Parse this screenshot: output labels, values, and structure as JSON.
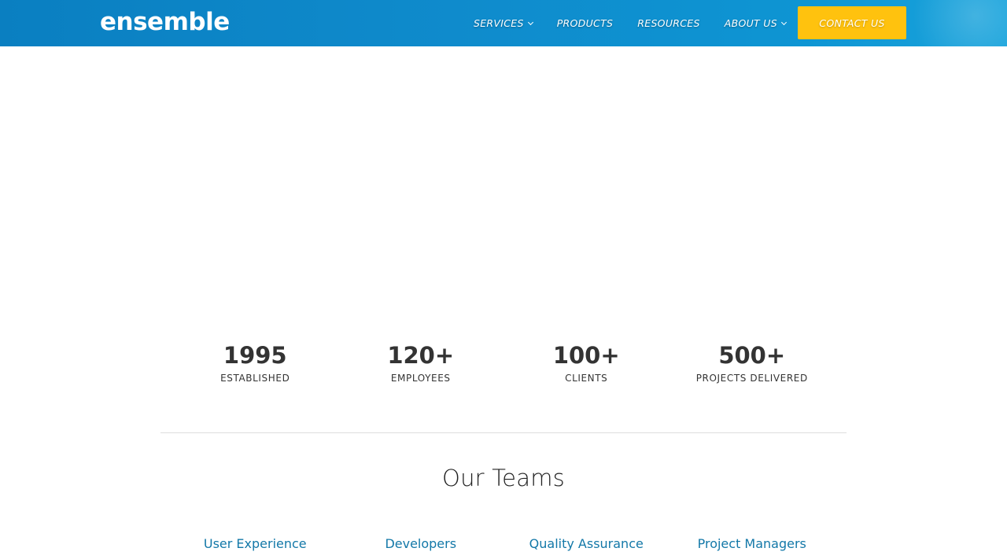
{
  "header": {
    "logo": "ensemble",
    "nav": [
      {
        "label": "SERVICES",
        "has_dropdown": true
      },
      {
        "label": "PRODUCTS",
        "has_dropdown": false
      },
      {
        "label": "RESOURCES",
        "has_dropdown": false
      },
      {
        "label": "ABOUT US",
        "has_dropdown": true
      }
    ],
    "contact_label": "CONTACT US"
  },
  "stats": [
    {
      "value": "1995",
      "label": "ESTABLISHED"
    },
    {
      "value": "120+",
      "label": "EMPLOYEES"
    },
    {
      "value": "100+",
      "label": "CLIENTS"
    },
    {
      "value": "500+",
      "label": "PROJECTS DELIVERED"
    }
  ],
  "teams_section": {
    "title": "Our Teams",
    "teams": [
      "User Experience",
      "Developers",
      "Quality Assurance",
      "Project Managers"
    ]
  },
  "colors": {
    "header_blue": "#0f8bcc",
    "contact_yellow": "#ffc20e",
    "link_blue": "#1378a8",
    "text_dark": "#333333"
  },
  "icons": {
    "dropdown": "chevron-down-icon"
  }
}
